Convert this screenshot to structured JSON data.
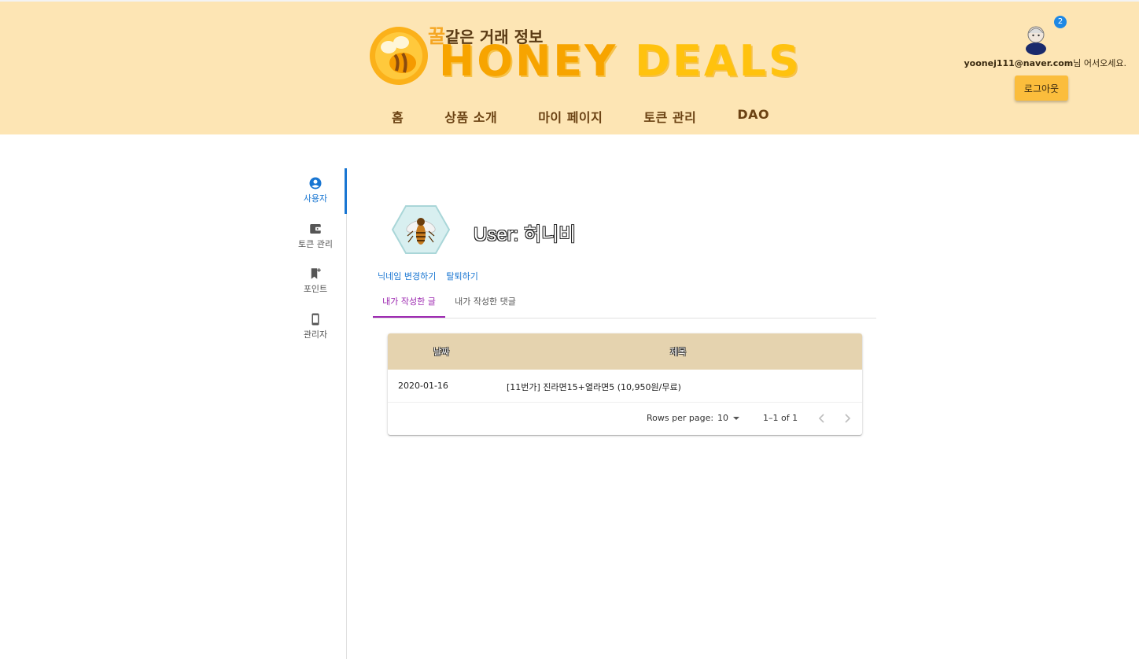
{
  "header": {
    "logo": {
      "tagline_honey": "꿀",
      "tagline_rest": "같은 거래 정보",
      "title_main": "HONEY",
      "title_accent": "DEALS"
    },
    "nav": [
      {
        "label": "홈"
      },
      {
        "label": "상품 소개"
      },
      {
        "label": "마이 페이지"
      },
      {
        "label": "토큰 관리"
      },
      {
        "label": "DAO"
      }
    ],
    "user": {
      "notification_count": "2",
      "email": "yoonej111@naver.com",
      "greeting_suffix": "님 어서오세요.",
      "logout_label": "로그아웃"
    }
  },
  "sidebar": {
    "items": [
      {
        "label": "사용자",
        "icon": "account-circle-icon",
        "active": true
      },
      {
        "label": "토큰 관리",
        "icon": "wallet-icon",
        "active": false
      },
      {
        "label": "포인트",
        "icon": "bookmark-add-icon",
        "active": false
      },
      {
        "label": "관리자",
        "icon": "phone-icon",
        "active": false
      }
    ]
  },
  "profile": {
    "title": "User: 허니비",
    "links": {
      "change_nickname": "닉네임 변경하기",
      "withdraw": "탈퇴하기"
    },
    "tabs": [
      {
        "label": "내가 작성한 글",
        "active": true
      },
      {
        "label": "내가 작성한 댓글",
        "active": false
      }
    ]
  },
  "table": {
    "columns": [
      "날짜",
      "제목"
    ],
    "rows": [
      {
        "date": "2020-01-16",
        "title": "[11번가] 진라면15+열라면5 (10,950원/무료)"
      }
    ],
    "pagination": {
      "rows_per_page_label": "Rows per page:",
      "rows_per_page_value": "10",
      "range": "1–1 of 1"
    }
  },
  "colors": {
    "header_bg": "#fde5b4",
    "table_header_bg": "#e5d3af",
    "accent_blue": "#1976d2",
    "tab_purple": "#9c27b0",
    "logout_bg": "#fbbd3c"
  }
}
